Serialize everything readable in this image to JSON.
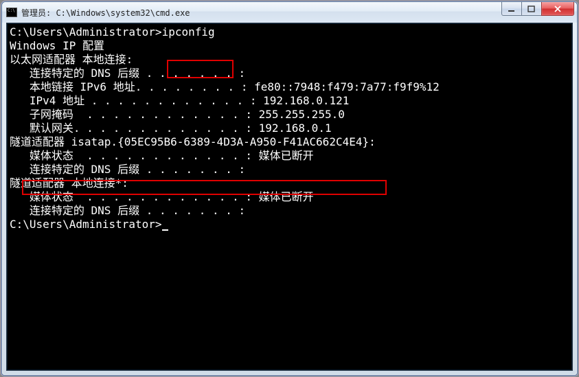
{
  "window": {
    "title": "管理员: C:\\Windows\\system32\\cmd.exe"
  },
  "terminal": {
    "prompt1_path": "C:\\Users\\Administrator>",
    "prompt1_cmd": "ipconfig",
    "blank": "",
    "header": "Windows IP 配置",
    "adapter1_title": "以太网适配器 本地连接:",
    "adapter1_dns": "   连接特定的 DNS 后缀 . . . . . . . :",
    "adapter1_ipv6": "   本地链接 IPv6 地址. . . . . . . . : fe80::7948:f479:7a77:f9f9%12",
    "adapter1_ipv4": "   IPv4 地址 . . . . . . . . . . . . : 192.168.0.121",
    "adapter1_mask": "   子网掩码  . . . . . . . . . . . . : 255.255.255.0",
    "adapter1_gw": "   默认网关. . . . . . . . . . . . . : 192.168.0.1",
    "tunnel1_title": "隧道适配器 isatap.{05EC95B6-6389-4D3A-A950-F41AC662C4E4}:",
    "tunnel1_media": "   媒体状态  . . . . . . . . . . . . : 媒体已断开",
    "tunnel1_dns": "   连接特定的 DNS 后缀 . . . . . . . :",
    "tunnel2_title": "隧道适配器 本地连接*:",
    "tunnel2_media": "   媒体状态  . . . . . . . . . . . . : 媒体已断开",
    "tunnel2_dns": "   连接特定的 DNS 后缀 . . . . . . . :",
    "prompt2_path": "C:\\Users\\Administrator>"
  }
}
